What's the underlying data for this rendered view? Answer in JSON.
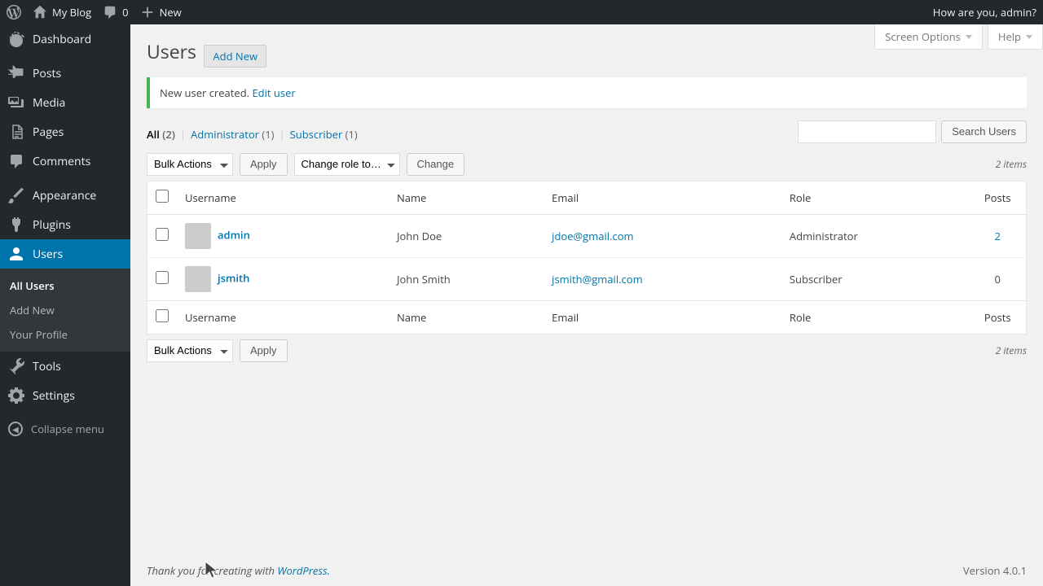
{
  "adminbar": {
    "site_name": "My Blog",
    "comments_count": "0",
    "new_label": "New",
    "greeting": "How are you, admin?"
  },
  "sidebar": {
    "items": [
      {
        "label": "Dashboard"
      },
      {
        "label": "Posts"
      },
      {
        "label": "Media"
      },
      {
        "label": "Pages"
      },
      {
        "label": "Comments"
      },
      {
        "label": "Appearance"
      },
      {
        "label": "Plugins"
      },
      {
        "label": "Users"
      },
      {
        "label": "Tools"
      },
      {
        "label": "Settings"
      }
    ],
    "submenu": [
      {
        "label": "All Users"
      },
      {
        "label": "Add New"
      },
      {
        "label": "Your Profile"
      }
    ],
    "collapse": "Collapse menu"
  },
  "screen": {
    "options": "Screen Options",
    "help": "Help"
  },
  "page": {
    "title": "Users",
    "add_new": "Add New"
  },
  "notice": {
    "text": "New user created. ",
    "link": "Edit user"
  },
  "filters": {
    "all": "All",
    "all_count": "(2)",
    "administrator": "Administrator",
    "admin_count": "(1)",
    "subscriber": "Subscriber",
    "sub_count": "(1)"
  },
  "search": {
    "button": "Search Users"
  },
  "bulk": {
    "actions": "Bulk Actions",
    "apply": "Apply",
    "change_role": "Change role to…",
    "change": "Change"
  },
  "count_text": "2 items",
  "table": {
    "headers": {
      "username": "Username",
      "name": "Name",
      "email": "Email",
      "role": "Role",
      "posts": "Posts"
    },
    "rows": [
      {
        "username": "admin",
        "name": "John Doe",
        "email": "jdoe@gmail.com",
        "role": "Administrator",
        "posts": "2"
      },
      {
        "username": "jsmith",
        "name": "John Smith",
        "email": "jsmith@gmail.com",
        "role": "Subscriber",
        "posts": "0"
      }
    ]
  },
  "footer": {
    "thank": "Thank you for creating with ",
    "wp": "WordPress.",
    "version": "Version 4.0.1"
  }
}
